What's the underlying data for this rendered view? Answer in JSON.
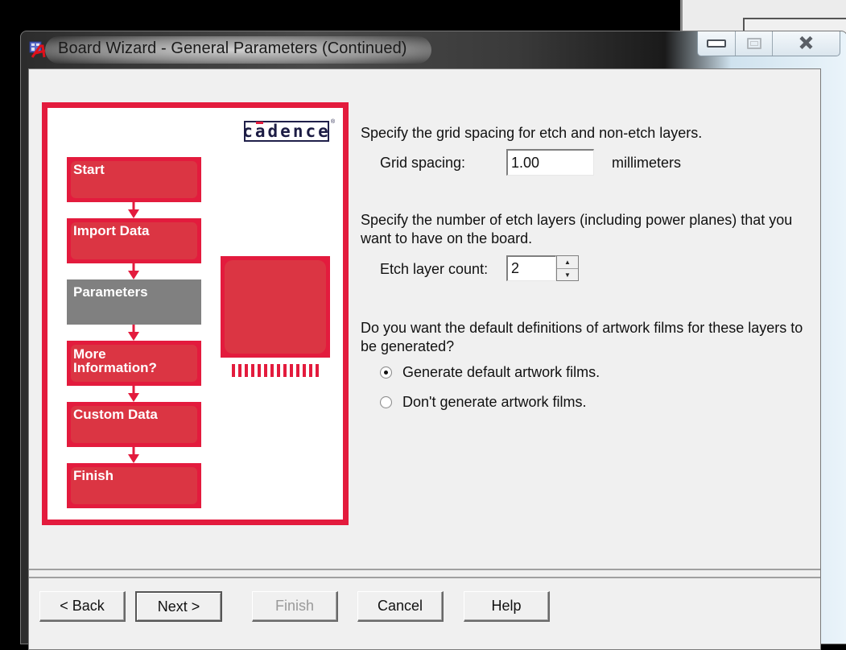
{
  "window": {
    "title": "Board Wizard - General Parameters (Continued)",
    "icon": "board-wizard-app-icon",
    "caption_buttons": {
      "minimize": "minimize-icon",
      "maximize": "maximize-icon",
      "close": "close-icon"
    }
  },
  "graphic": {
    "logo_text": "cadence",
    "logo_mark": "®",
    "steps": [
      {
        "label": "Start",
        "active": false
      },
      {
        "label": "Import Data",
        "active": false
      },
      {
        "label": "Parameters",
        "active": true
      },
      {
        "label": "More Information?",
        "active": false
      },
      {
        "label": "Custom Data",
        "active": false
      },
      {
        "label": "Finish",
        "active": false
      }
    ],
    "accent_color": "#e31b3d",
    "active_step_color": "#808080"
  },
  "form": {
    "grid_prompt": "Specify the grid spacing for etch and non-etch layers.",
    "grid_label": "Grid spacing:",
    "grid_value": "1.00",
    "grid_units": "millimeters",
    "etch_prompt_line1": "Specify the number of etch layers (including power planes) that you",
    "etch_prompt_line2": "want to have on the board.",
    "etch_label": "Etch layer count:",
    "etch_value": "2",
    "artwork_prompt_line1": "Do you want the default definitions of artwork films for these layers to",
    "artwork_prompt_line2": "be generated?",
    "artwork_options": [
      {
        "label": "Generate default artwork films.",
        "checked": true
      },
      {
        "label": "Don't generate artwork films.",
        "checked": false
      }
    ]
  },
  "buttons": {
    "back": "< Back",
    "next": "Next >",
    "finish": "Finish",
    "cancel": "Cancel",
    "help": "Help"
  }
}
